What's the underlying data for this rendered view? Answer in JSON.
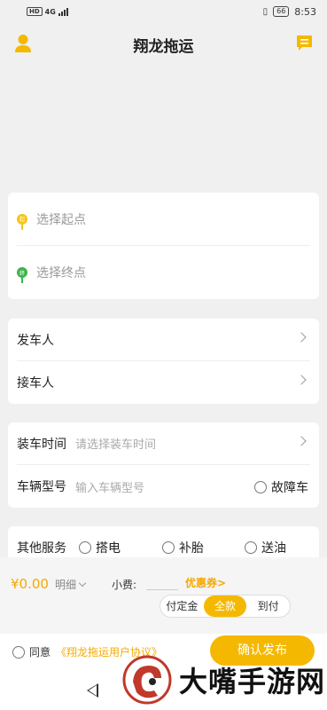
{
  "status_bar": {
    "hd": "HD",
    "network": "4G",
    "battery": "66",
    "time": "8:53"
  },
  "header": {
    "title": "翔龙拖运",
    "user_icon": "user-icon",
    "message_icon": "message-icon"
  },
  "route": {
    "start_pin": "起",
    "start_placeholder": "选择起点",
    "end_pin": "终",
    "end_placeholder": "选择终点"
  },
  "people": {
    "sender_label": "发车人",
    "receiver_label": "接车人"
  },
  "vehicle": {
    "load_time_label": "装车时间",
    "load_time_placeholder": "请选择装车时间",
    "model_label": "车辆型号",
    "model_placeholder": "输入车辆型号",
    "fault_label": "故障车"
  },
  "services": {
    "label": "其他服务",
    "options": [
      "搭电",
      "补胎",
      "送油"
    ]
  },
  "payment": {
    "price": "¥0.00",
    "detail": "明细",
    "tip_label": "小费:",
    "coupon": "优惠券>",
    "options": [
      "付定金",
      "全款",
      "到付"
    ],
    "selected": "全款"
  },
  "footer": {
    "agree": "同意",
    "agreement_link": "《翔龙拖运用户协议》",
    "confirm": "确认发布"
  },
  "watermark": {
    "text": "大嘴手游网"
  },
  "colors": {
    "accent": "#f5b800",
    "start_pin": "#f5c518",
    "end_pin": "#3bb54a"
  }
}
